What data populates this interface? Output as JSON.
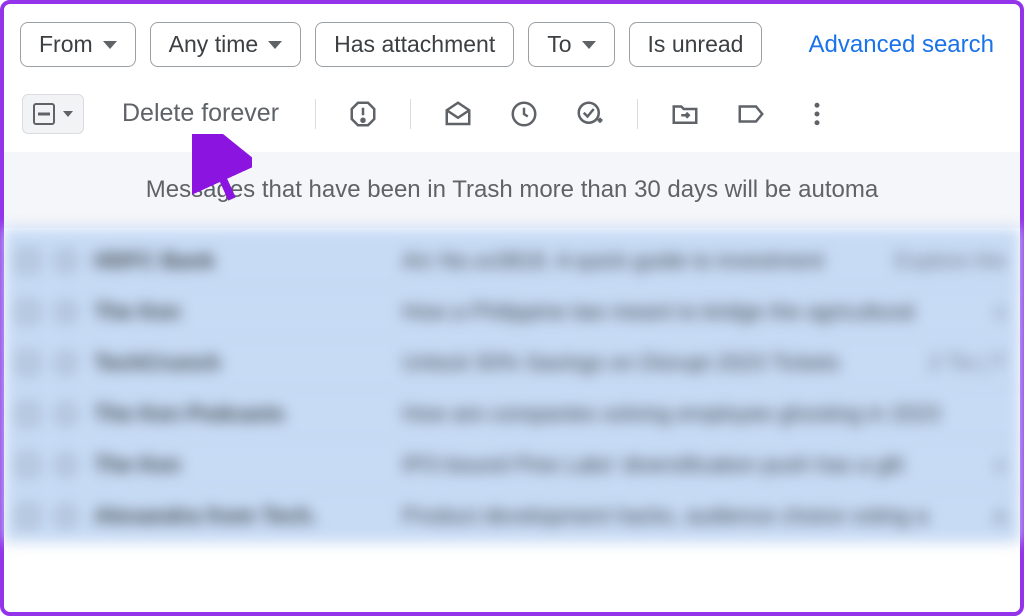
{
  "filters": {
    "from": "From",
    "anytime": "Any time",
    "has_attachment": "Has attachment",
    "to": "To",
    "is_unread": "Is unread",
    "advanced": "Advanced search"
  },
  "toolbar": {
    "delete_forever": "Delete forever"
  },
  "banner": {
    "text": "Messages that have been in Trash more than 30 days will be automa"
  },
  "rows": [
    {
      "sender": "HDFC Bank",
      "subject": "A/c No.xx3818. A quick guide to investment",
      "meta": "Explore the"
    },
    {
      "sender": "The Ken",
      "subject": "How a Philippine law meant to bridge the agricultural",
      "meta": "c"
    },
    {
      "sender": "TechCrunch",
      "subject": "Unlock 50% Savings on Disrupt 2023 Tickets",
      "meta": "2 Tix | T"
    },
    {
      "sender": "The Ken Podcasts",
      "subject": "How are companies solving employee ghosting in 2023",
      "meta": ""
    },
    {
      "sender": "The Ken",
      "subject": "IPO-bound Pine Labs' diversification push has a glit",
      "meta": "c"
    },
    {
      "sender": "Alexandra from Tech.",
      "subject": "Product development hacks, audience choice voting a",
      "meta": "a"
    }
  ]
}
